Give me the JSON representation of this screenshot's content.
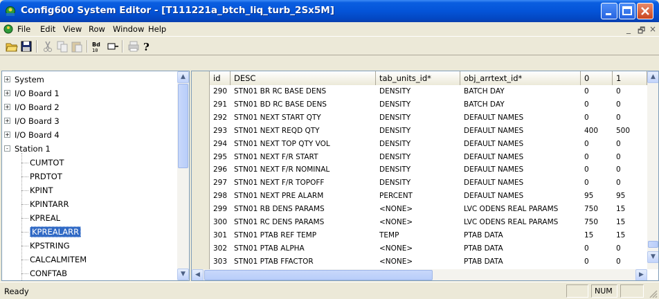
{
  "window": {
    "title": "Config600 System Editor - [T111221a_btch_liq_turb_2Sx5M]"
  },
  "menu": {
    "items": [
      "File",
      "Edit",
      "View",
      "Row",
      "Window",
      "Help"
    ],
    "mdi_controls": [
      "_",
      "̅❐",
      "×"
    ]
  },
  "toolbar": {
    "buttons": [
      "open-icon",
      "save-icon",
      "cut-icon",
      "copy-icon",
      "paste-icon",
      "build-icon",
      "connect-icon",
      "print-icon",
      "help-icon"
    ]
  },
  "tree": {
    "items": [
      {
        "label": "System",
        "level": 0,
        "expander": "+"
      },
      {
        "label": "I/O Board 1",
        "level": 0,
        "expander": "+"
      },
      {
        "label": "I/O Board 2",
        "level": 0,
        "expander": "+"
      },
      {
        "label": "I/O Board 3",
        "level": 0,
        "expander": "+"
      },
      {
        "label": "I/O Board 4",
        "level": 0,
        "expander": "+"
      },
      {
        "label": "Station 1",
        "level": 0,
        "expander": "-"
      },
      {
        "label": "CUMTOT",
        "level": 1
      },
      {
        "label": "PRDTOT",
        "level": 1
      },
      {
        "label": "KPINT",
        "level": 1
      },
      {
        "label": "KPINTARR",
        "level": 1
      },
      {
        "label": "KPREAL",
        "level": 1
      },
      {
        "label": "KPREALARR",
        "level": 1,
        "selected": true
      },
      {
        "label": "KPSTRING",
        "level": 1
      },
      {
        "label": "CALCALMITEM",
        "level": 1
      },
      {
        "label": "CONFTAB",
        "level": 1
      }
    ]
  },
  "grid": {
    "columns": [
      "id",
      "DESC",
      "tab_units_id*",
      "obj_arrtext_id*",
      "0",
      "1"
    ],
    "rows": [
      [
        "290",
        "STN01 BR RC BASE DENS",
        "DENSITY",
        "BATCH DAY",
        "0",
        "0"
      ],
      [
        "291",
        "STN01 BD RC BASE DENS",
        "DENSITY",
        "BATCH DAY",
        "0",
        "0"
      ],
      [
        "292",
        "STN01 NEXT START QTY",
        "DENSITY",
        "DEFAULT NAMES",
        "0",
        "0"
      ],
      [
        "293",
        "STN01 NEXT REQD QTY",
        "DENSITY",
        "DEFAULT NAMES",
        "400",
        "500"
      ],
      [
        "294",
        "STN01 NEXT TOP QTY VOL",
        "DENSITY",
        "DEFAULT NAMES",
        "0",
        "0"
      ],
      [
        "295",
        "STN01 NEXT F/R START",
        "DENSITY",
        "DEFAULT NAMES",
        "0",
        "0"
      ],
      [
        "296",
        "STN01 NEXT F/R NOMINAL",
        "DENSITY",
        "DEFAULT NAMES",
        "0",
        "0"
      ],
      [
        "297",
        "STN01 NEXT F/R TOPOFF",
        "DENSITY",
        "DEFAULT NAMES",
        "0",
        "0"
      ],
      [
        "298",
        "STN01 NEXT PRE ALARM",
        "PERCENT",
        "DEFAULT NAMES",
        "95",
        "95"
      ],
      [
        "299",
        "STN01 RB DENS PARAMS",
        "<NONE>",
        "LVC ODENS REAL PARAMS",
        "750",
        "15"
      ],
      [
        "300",
        "STN01 RC DENS PARAMS",
        "<NONE>",
        "LVC ODENS REAL PARAMS",
        "750",
        "15"
      ],
      [
        "301",
        "STN01 PTAB REF TEMP",
        "TEMP",
        "PTAB DATA",
        "15",
        "15"
      ],
      [
        "302",
        "STN01 PTAB ALPHA",
        "<NONE>",
        "PTAB DATA",
        "0",
        "0"
      ],
      [
        "303",
        "STN01 PTAB FFACTOR",
        "<NONE>",
        "PTAB DATA",
        "0",
        "0"
      ]
    ]
  },
  "status": {
    "text": "Ready",
    "num": "NUM"
  },
  "colors": {
    "title_blue": "#0454d8",
    "selection": "#316ac5"
  }
}
